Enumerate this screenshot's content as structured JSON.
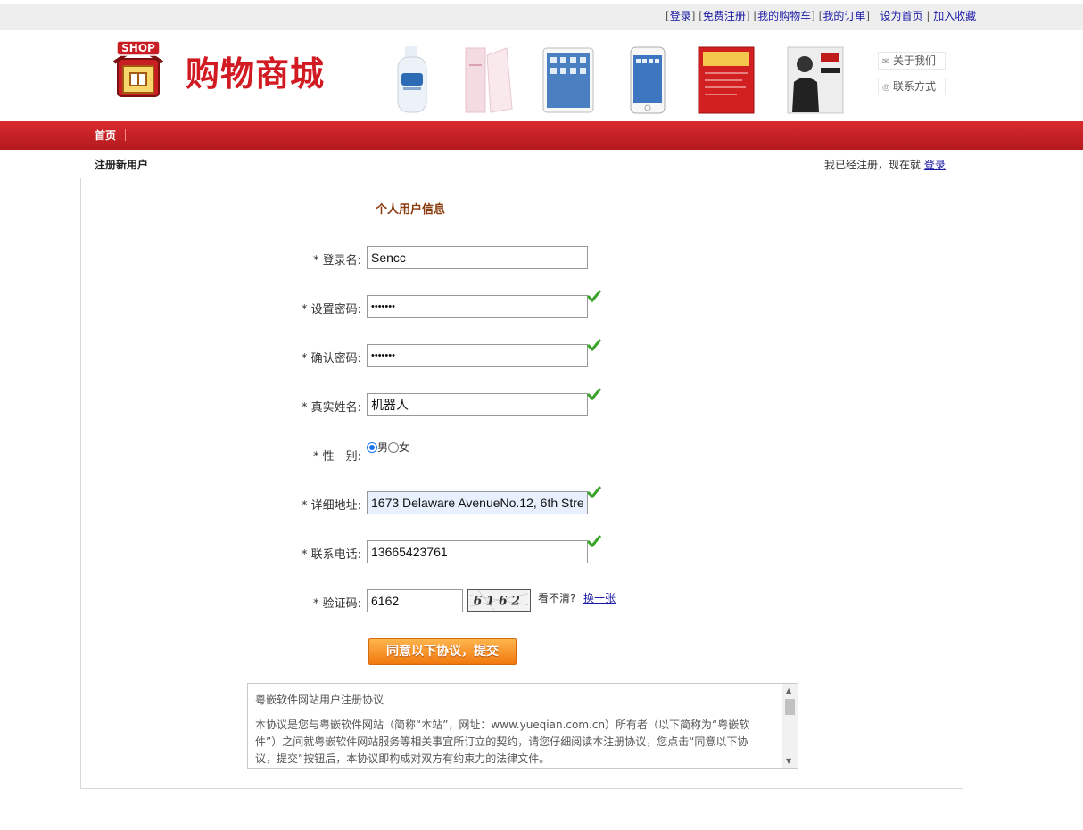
{
  "topbar": {
    "links": [
      {
        "label": "登录"
      },
      {
        "label": "免费注册"
      },
      {
        "label": "我的购物车"
      },
      {
        "label": "我的订单"
      },
      {
        "label": "设为首页"
      },
      {
        "label": "加入收藏"
      }
    ]
  },
  "header": {
    "logo_text": "SHOP",
    "brand": "购物商城",
    "products": [
      {
        "name": "cleanser-bottle"
      },
      {
        "name": "facial-foam-tube"
      },
      {
        "name": "ipad-tablet"
      },
      {
        "name": "iphone"
      },
      {
        "name": "red-book"
      },
      {
        "name": "java-book"
      }
    ],
    "side_links": [
      {
        "label": "关于我们",
        "icon": "mail-icon"
      },
      {
        "label": "联系方式",
        "icon": "contact-icon"
      }
    ]
  },
  "nav": {
    "home": "首页"
  },
  "subbar": {
    "title": "注册新用户",
    "already": "我已经注册，现在就",
    "login": "登录"
  },
  "form": {
    "section_title": "个人用户信息",
    "username": {
      "label": "* 登录名:",
      "value": "Sencc"
    },
    "password": {
      "label": "* 设置密码:",
      "value": "•••••••"
    },
    "confirm": {
      "label": "* 确认密码:",
      "value": "•••••••"
    },
    "realname": {
      "label": "* 真实姓名:",
      "value": "机器人"
    },
    "gender": {
      "label": "* 性　别:",
      "male": "男",
      "female": "女",
      "selected": "男"
    },
    "address": {
      "label": "* 详细地址:",
      "value": "1673 Delaware AvenueNo.12, 6th Stre"
    },
    "phone": {
      "label": "* 联系电话:",
      "value": "13665423761"
    },
    "captcha": {
      "label": "* 验证码:",
      "value": "6162",
      "image_text": "6162",
      "hint": "看不清?",
      "refresh": "换一张"
    },
    "submit": "同意以下协议，提交"
  },
  "agreement": {
    "title": "粤嵌软件网站用户注册协议",
    "body": "本协议是您与粤嵌软件网站（简称“本站”，网址：www.yueqian.com.cn）所有者（以下简称为“粤嵌软件”）之间就粤嵌软件网站服务等相关事宜所订立的契约，请您仔细阅读本注册协议，您点击“同意以下协议，提交”按钮后，本协议即构成对双方有约束力的法律文件。"
  },
  "colors": {
    "brand_red": "#d11a22",
    "nav_red": "#c82226",
    "section_brown": "#8a3b0e",
    "check_green": "#3aa329",
    "submit_orange": "#f0780e"
  }
}
